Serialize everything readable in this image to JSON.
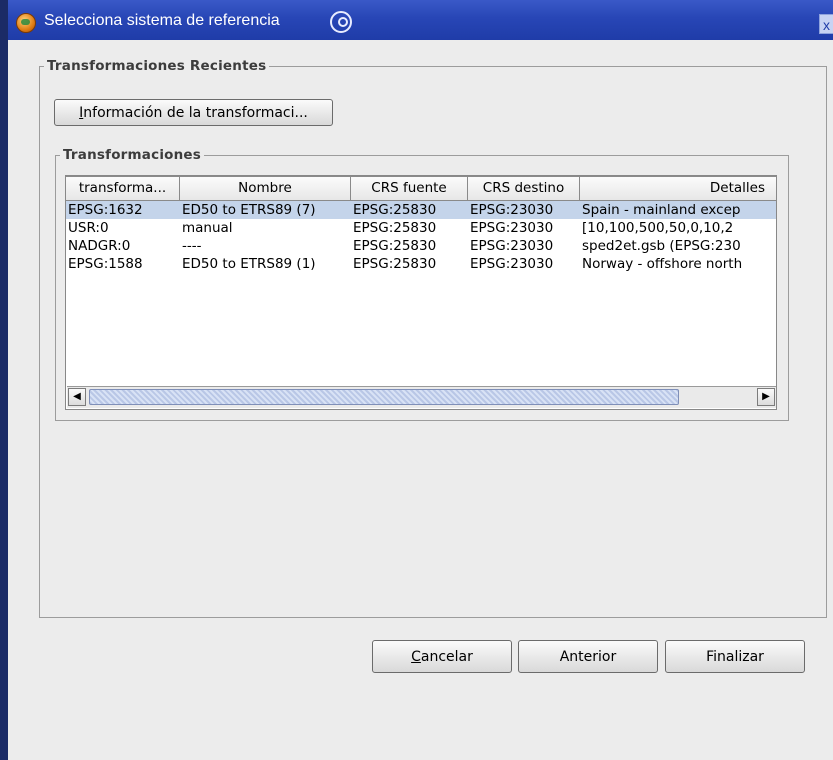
{
  "window": {
    "title": "Selecciona sistema de referencia",
    "close_label": "x"
  },
  "recent_group": {
    "legend": "Transformaciones Recientes",
    "info_button_first": "I",
    "info_button_rest": "nformación de la transformaci..."
  },
  "transform_group": {
    "legend": "Transformaciones"
  },
  "table": {
    "columns": [
      "transforma...",
      "Nombre",
      "CRS fuente",
      "CRS destino",
      "Detalles"
    ],
    "rows": [
      [
        "EPSG:1632",
        "ED50 to ETRS89 (7)",
        "EPSG:25830",
        "EPSG:23030",
        "Spain - mainland excep"
      ],
      [
        "USR:0",
        "manual",
        "EPSG:25830",
        "EPSG:23030",
        "[10,100,500,50,0,10,2"
      ],
      [
        "NADGR:0",
        "----",
        "EPSG:25830",
        "EPSG:23030",
        "sped2et.gsb (EPSG:230"
      ],
      [
        "EPSG:1588",
        "ED50 to ETRS89 (1)",
        "EPSG:25830",
        "EPSG:23030",
        "Norway - offshore north"
      ]
    ],
    "selected_row": 0,
    "scroll_left": "◀",
    "scroll_right": "▶"
  },
  "footer": {
    "cancel_mnemonic": "C",
    "cancel_rest": "ancelar",
    "previous": "Anterior",
    "finish": "Finalizar"
  },
  "colors": {
    "titlebar": "#2846b6",
    "selection": "#c4d4ea",
    "desktop": "#1b2b66"
  }
}
